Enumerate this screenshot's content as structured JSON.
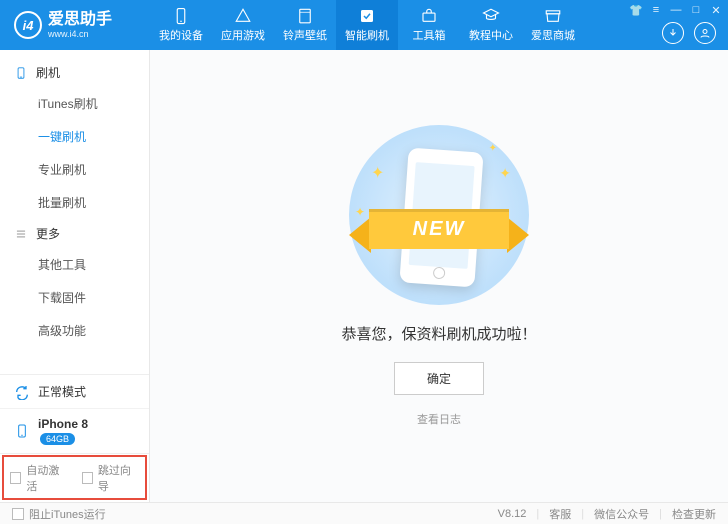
{
  "header": {
    "app_name": "爱思助手",
    "url": "www.i4.cn",
    "logo_text": "i4",
    "tabs": [
      {
        "label": "我的设备"
      },
      {
        "label": "应用游戏"
      },
      {
        "label": "铃声壁纸"
      },
      {
        "label": "智能刷机"
      },
      {
        "label": "工具箱"
      },
      {
        "label": "教程中心"
      },
      {
        "label": "爱思商城"
      }
    ]
  },
  "sidebar": {
    "group1_title": "刷机",
    "group1_items": [
      "iTunes刷机",
      "一键刷机",
      "专业刷机",
      "批量刷机"
    ],
    "group2_title": "更多",
    "group2_items": [
      "其他工具",
      "下载固件",
      "高级功能"
    ],
    "mode_label": "正常模式",
    "device_label": "iPhone 8",
    "device_badge": "64GB",
    "check_auto": "自动激活",
    "check_skip": "跳过向导"
  },
  "main": {
    "ribbon_text": "NEW",
    "message": "恭喜您，保资料刷机成功啦！",
    "ok_button": "确定",
    "view_log": "查看日志"
  },
  "footer": {
    "block_itunes": "阻止iTunes运行",
    "version": "V8.12",
    "support": "客服",
    "wechat": "微信公众号",
    "update": "检查更新"
  }
}
